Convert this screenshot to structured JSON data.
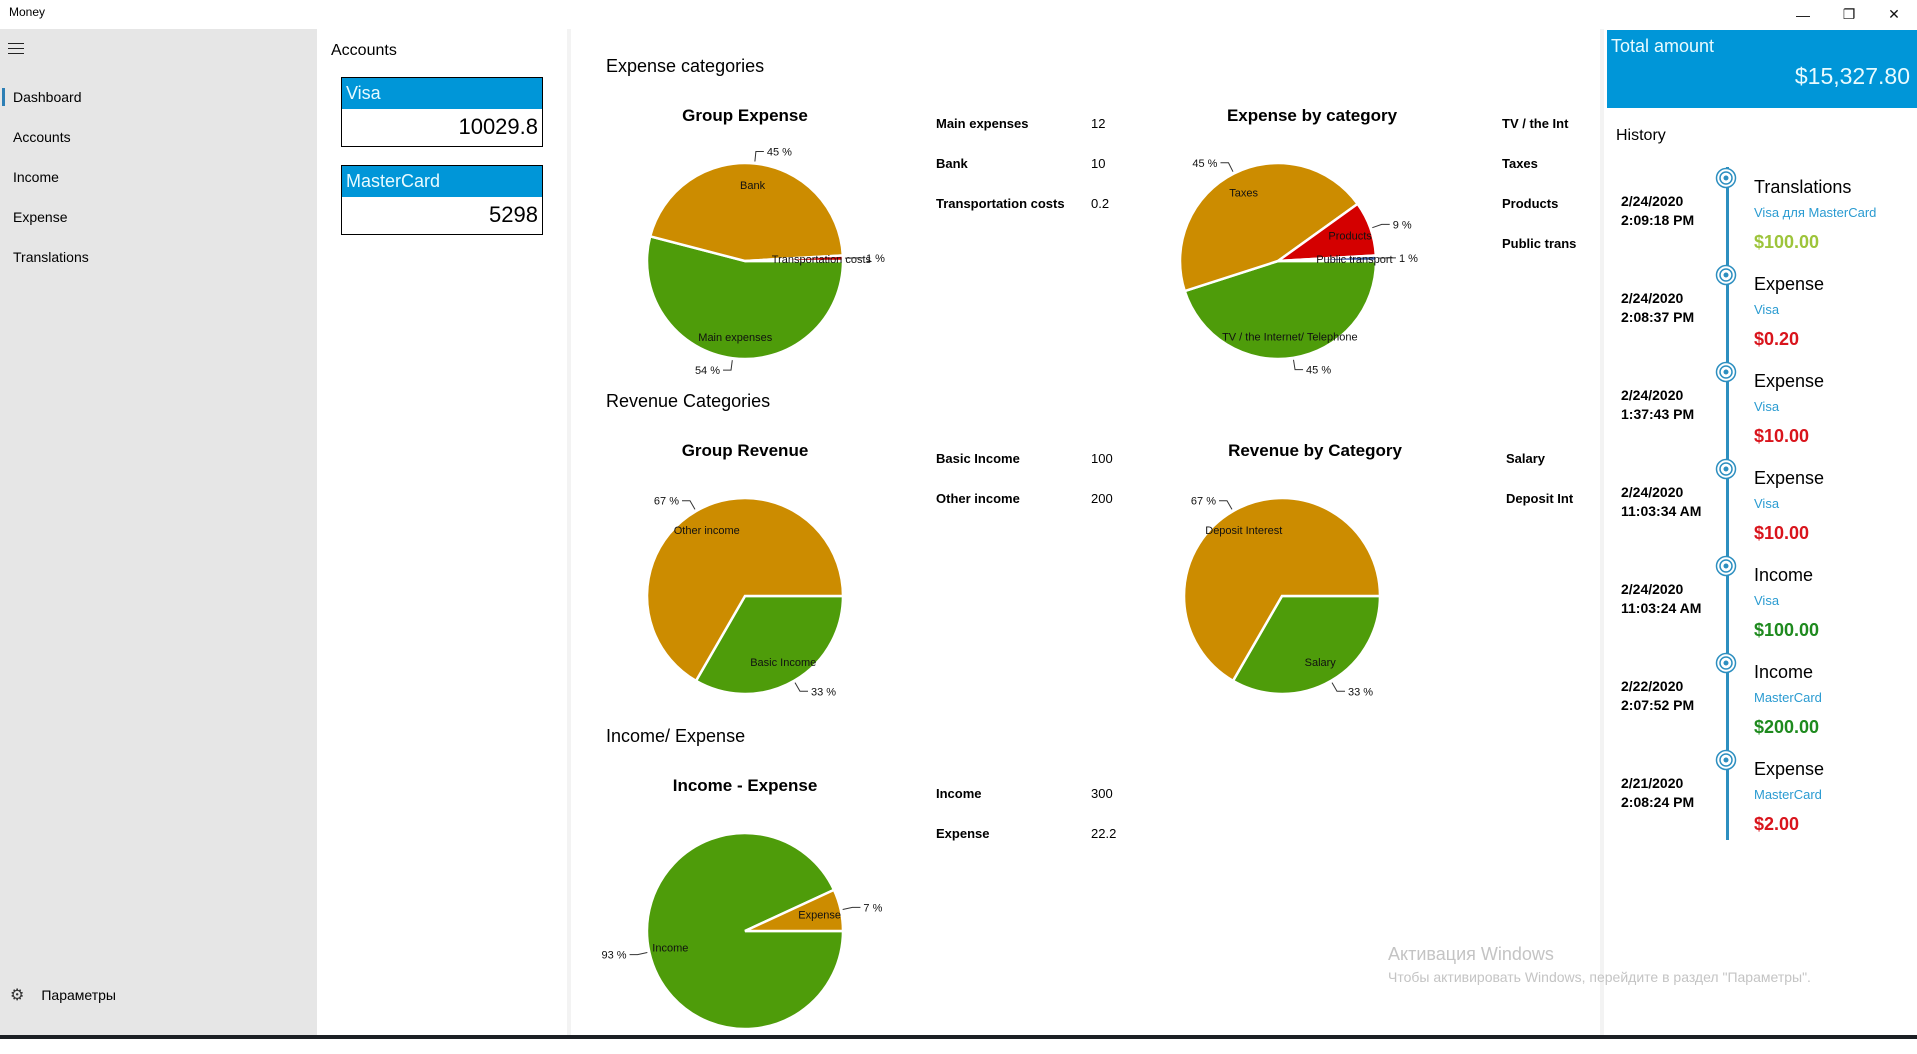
{
  "window": {
    "title": "Money",
    "controls": {
      "minimize": "—",
      "restore": "❐",
      "close": "✕"
    }
  },
  "sidebar": {
    "menu_icon": "hamburger-icon",
    "items": [
      {
        "label": "Dashboard",
        "active": true
      },
      {
        "label": "Accounts",
        "active": false
      },
      {
        "label": "Income",
        "active": false
      },
      {
        "label": "Expense",
        "active": false
      },
      {
        "label": "Translations",
        "active": false
      }
    ],
    "settings": {
      "icon": "gear-icon",
      "label": "Параметры"
    }
  },
  "accounts": {
    "title": "Accounts",
    "items": [
      {
        "name": "Visa",
        "balance": "10029.8"
      },
      {
        "name": "MasterCard",
        "balance": "5298"
      }
    ]
  },
  "colors": {
    "accent": "#0096d8",
    "pie_orange": "#cc8c00",
    "pie_green": "#4e9c0a",
    "pie_red": "#d40000",
    "pie_blue": "#3b5ea8",
    "income_green": "#1e8a1e",
    "transfer_green": "#9dc43a",
    "expense_red": "#d9141c",
    "timeline": "#2d8fc0"
  },
  "main": {
    "sections": [
      {
        "title": "Expense categories"
      },
      {
        "title": "Revenue Categories"
      },
      {
        "title": "Income/ Expense"
      }
    ],
    "legends": {
      "group_expense": [
        {
          "name": "Main expenses",
          "value": "12"
        },
        {
          "name": "Bank",
          "value": "10"
        },
        {
          "name": "Transportation costs",
          "value": "0.2"
        }
      ],
      "expense_by_category": [
        {
          "name": "TV / the Int"
        },
        {
          "name": "Taxes"
        },
        {
          "name": "Products"
        },
        {
          "name": "Public trans"
        }
      ],
      "group_revenue": [
        {
          "name": "Basic Income",
          "value": "100"
        },
        {
          "name": "Other income",
          "value": "200"
        }
      ],
      "revenue_by_category": [
        {
          "name": "Salary"
        },
        {
          "name": "Deposit Int"
        }
      ],
      "income_expense": [
        {
          "name": "Income",
          "value": "300"
        },
        {
          "name": "Expense",
          "value": "22.2"
        }
      ]
    }
  },
  "chart_data": [
    {
      "id": "group_expense",
      "type": "pie",
      "title": "Group Expense",
      "slices": [
        {
          "label": "Main expenses",
          "value": 12,
          "percent_label": "54 %",
          "color": "#4e9c0a"
        },
        {
          "label": "Bank",
          "value": 10,
          "percent_label": "45 %",
          "color": "#cc8c00"
        },
        {
          "label": "Transportation costs",
          "value": 0.2,
          "percent_label": "1 %",
          "color": "#d40000"
        }
      ]
    },
    {
      "id": "expense_by_category",
      "type": "pie",
      "title": "Expense by category",
      "slices": [
        {
          "label": "TV / the Internet/ Telephone",
          "value": 10,
          "percent_label": "45 %",
          "color": "#4e9c0a"
        },
        {
          "label": "Taxes",
          "value": 10,
          "percent_label": "45 %",
          "color": "#cc8c00"
        },
        {
          "label": "Products",
          "value": 2,
          "percent_label": "9 %",
          "color": "#d40000"
        },
        {
          "label": "Public transport",
          "value": 0.2,
          "percent_label": "1 %",
          "color": "#3b5ea8"
        }
      ]
    },
    {
      "id": "group_revenue",
      "type": "pie",
      "title": "Group Revenue",
      "slices": [
        {
          "label": "Basic Income",
          "value": 100,
          "percent_label": "33 %",
          "color": "#4e9c0a"
        },
        {
          "label": "Other income",
          "value": 200,
          "percent_label": "67 %",
          "color": "#cc8c00"
        }
      ]
    },
    {
      "id": "revenue_by_category",
      "type": "pie",
      "title": "Revenue by Category",
      "slices": [
        {
          "label": "Salary",
          "value": 100,
          "percent_label": "33 %",
          "color": "#4e9c0a"
        },
        {
          "label": "Deposit Interest",
          "value": 200,
          "percent_label": "67 %",
          "color": "#cc8c00"
        }
      ]
    },
    {
      "id": "income_expense",
      "type": "pie",
      "title": "Income - Expense",
      "slices": [
        {
          "label": "Income",
          "value": 300,
          "percent_label": "93 %",
          "color": "#4e9c0a"
        },
        {
          "label": "Expense",
          "value": 22.2,
          "percent_label": "7 %",
          "color": "#cc8c00"
        }
      ]
    }
  ],
  "history": {
    "total_label": "Total amount",
    "total_value": "$15,327.80",
    "title": "History",
    "items": [
      {
        "date": "2/24/2020",
        "time": "2:09:18 PM",
        "type": "Translations",
        "account": "Visa для MasterCard",
        "amount": "$100.00",
        "kind": "transfer"
      },
      {
        "date": "2/24/2020",
        "time": "2:08:37 PM",
        "type": "Expense",
        "account": "Visa",
        "amount": "$0.20",
        "kind": "expense"
      },
      {
        "date": "2/24/2020",
        "time": "1:37:43 PM",
        "type": "Expense",
        "account": "Visa",
        "amount": "$10.00",
        "kind": "expense"
      },
      {
        "date": "2/24/2020",
        "time": "11:03:34 AM",
        "type": "Expense",
        "account": "Visa",
        "amount": "$10.00",
        "kind": "expense"
      },
      {
        "date": "2/24/2020",
        "time": "11:03:24 AM",
        "type": "Income",
        "account": "Visa",
        "amount": "$100.00",
        "kind": "income"
      },
      {
        "date": "2/22/2020",
        "time": "2:07:52 PM",
        "type": "Income",
        "account": "MasterCard",
        "amount": "$200.00",
        "kind": "income"
      },
      {
        "date": "2/21/2020",
        "time": "2:08:24 PM",
        "type": "Expense",
        "account": "MasterCard",
        "amount": "$2.00",
        "kind": "expense"
      }
    ]
  },
  "watermark": {
    "title": "Активация Windows",
    "subtitle": "Чтобы активировать Windows, перейдите в раздел \"Параметры\"."
  }
}
